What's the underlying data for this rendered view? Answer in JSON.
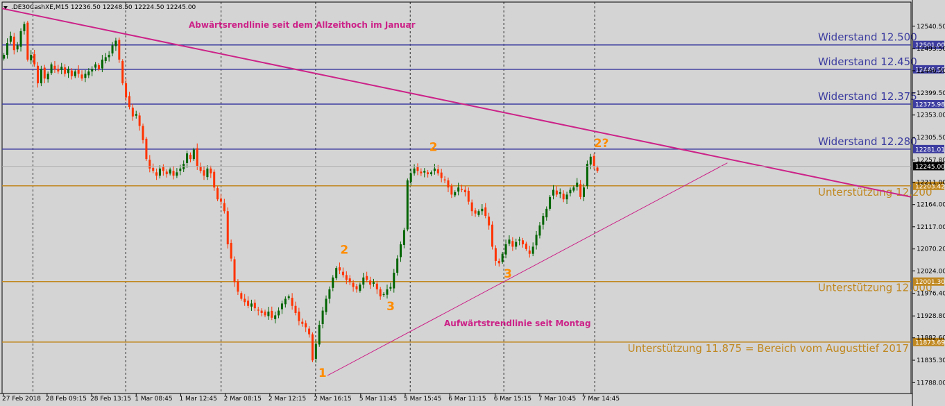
{
  "header": {
    "symbol": ".DE30CashXE,M15",
    "ohlc": "12236.50 12248.50 12224.50 12245.00",
    "full": ".DE30CashXE,M15  12236.50 12248.50 12224.50 12245.00"
  },
  "colors": {
    "background": "#d4d4d4",
    "grid": "#000000",
    "bull": "#006400",
    "bear": "#ff3300",
    "resistance": "#3c3ca0",
    "support": "#c08820",
    "trend": "#cc2288",
    "count": "#ff8c00",
    "axis_bg": "#ffffff"
  },
  "chart_data": {
    "type": "candlestick",
    "ylim": [
      11765,
      12590
    ],
    "y_ticks": [
      "12540.50",
      "12493.50",
      "12446.50",
      "12399.50",
      "12353.00",
      "12305.50",
      "12257.80",
      "12211.00",
      "12164.00",
      "12117.00",
      "12070.20",
      "12024.00",
      "11976.40",
      "11928.80",
      "11882.60",
      "11835.30",
      "11788.00"
    ],
    "x_ticks": [
      "27 Feb 2018",
      "28 Feb 09:15",
      "28 Feb 13:15",
      "1 Mar 08:45",
      "1 Mar 12:45",
      "2 Mar 08:15",
      "2 Mar 12:15",
      "2 Mar 16:15",
      "5 Mar 11:45",
      "5 Mar 15:45",
      "6 Mar 11:15",
      "6 Mar 15:15",
      "7 Mar 10:45",
      "7 Mar 14:45"
    ],
    "last_price": "12245.00",
    "levels": [
      {
        "value": 12501.0,
        "price_label": "12501.00",
        "text": "Widerstand 12.500",
        "kind": "resistance"
      },
      {
        "value": 12449.5,
        "price_label": "12449.50",
        "text": "Widerstand 12.450",
        "kind": "resistance"
      },
      {
        "value": 12375.98,
        "price_label": "12375.98",
        "text": "Widerstand 12.375",
        "kind": "resistance"
      },
      {
        "value": 12281.01,
        "price_label": "12281.01",
        "text": "Widerstand 12.280",
        "kind": "resistance"
      },
      {
        "value": 12203.42,
        "price_label": "12203.42",
        "text": "Unterstützung 12.200",
        "kind": "support"
      },
      {
        "value": 12001.3,
        "price_label": "12001.30",
        "text": "Unterstützung 12.000",
        "kind": "support"
      },
      {
        "value": 11873.69,
        "price_label": "11873.69",
        "text": "Unterstützung 11.875 = Bereich vom Augusttief 2017",
        "kind": "support"
      }
    ],
    "trendlines": [
      {
        "text": "Abwärtsrendlinie seit dem Allzeithoch im Januar",
        "start": [
          0,
          12578
        ],
        "end": [
          1.0,
          12180
        ]
      },
      {
        "text": "Aufwärtstrendlinie seit Montag",
        "start": [
          0.358,
          11803
        ],
        "end": [
          0.798,
          12252
        ]
      }
    ],
    "wave_labels": [
      {
        "text": "1",
        "x": 0.348,
        "y": 11800
      },
      {
        "text": "2",
        "x": 0.372,
        "y": 12060
      },
      {
        "text": "3",
        "x": 0.423,
        "y": 11941
      },
      {
        "text": "2",
        "x": 0.47,
        "y": 12277
      },
      {
        "text": "3",
        "x": 0.552,
        "y": 12010
      },
      {
        "text": "2?",
        "x": 0.651,
        "y": 12285
      }
    ],
    "prices": [
      12480,
      12505,
      12520,
      12490,
      12500,
      12530,
      12545,
      12470,
      12480,
      12460,
      12420,
      12450,
      12430,
      12440,
      12460,
      12450,
      12445,
      12455,
      12440,
      12450,
      12435,
      12445,
      12440,
      12430,
      12440,
      12445,
      12450,
      12460,
      12450,
      12470,
      12475,
      12480,
      12500,
      12510,
      12470,
      12420,
      12390,
      12370,
      12350,
      12355,
      12330,
      12300,
      12260,
      12240,
      12235,
      12225,
      12240,
      12235,
      12228,
      12238,
      12225,
      12232,
      12240,
      12250,
      12272,
      12260,
      12280,
      12245,
      12235,
      12225,
      12240,
      12230,
      12200,
      12175,
      12170,
      12150,
      12080,
      12050,
      12000,
      11980,
      11965,
      11958,
      11950,
      11955,
      11945,
      11940,
      11935,
      11930,
      11938,
      11925,
      11930,
      11940,
      11955,
      11965,
      11970,
      11950,
      11935,
      11918,
      11912,
      11905,
      11890,
      11835,
      11870,
      11910,
      11940,
      11965,
      11985,
      12010,
      12030,
      12025,
      12015,
      12005,
      12000,
      11990,
      11985,
      11995,
      12010,
      12005,
      11995,
      12000,
      11985,
      11970,
      11975,
      11985,
      11990,
      12020,
      12050,
      12080,
      12110,
      12215,
      12230,
      12240,
      12235,
      12230,
      12235,
      12228,
      12232,
      12240,
      12230,
      12220,
      12215,
      12200,
      12185,
      12190,
      12200,
      12195,
      12190,
      12170,
      12150,
      12145,
      12150,
      12155,
      12140,
      12120,
      12075,
      12045,
      12040,
      12060,
      12080,
      12090,
      12075,
      12085,
      12090,
      12080,
      12070,
      12060,
      12075,
      12100,
      12120,
      12140,
      12155,
      12180,
      12195,
      12185,
      12190,
      12175,
      12185,
      12195,
      12200,
      12210,
      12180,
      12200,
      12250,
      12265,
      12245,
      12235
    ]
  },
  "annotations": {
    "down_trend": "Abwärtsrendlinie seit dem Allzeithoch im Januar",
    "up_trend": "Aufwärtstrendlinie seit Montag"
  }
}
